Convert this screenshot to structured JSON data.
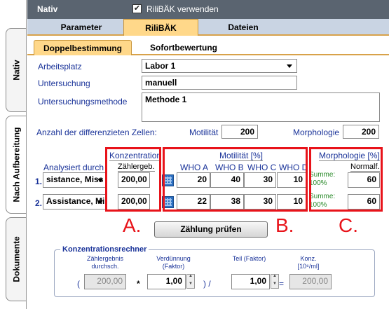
{
  "sidebar": {
    "tabs": [
      {
        "label": "Nativ"
      },
      {
        "label": "Nach Aufbereitung"
      },
      {
        "label": "Dokumente"
      }
    ]
  },
  "header": {
    "title": "Nativ",
    "checkbox_label": "RiliBÄK verwenden",
    "checkbox_checked": true
  },
  "tabs": [
    {
      "label": "Parameter"
    },
    {
      "label": "RiliBÄK"
    },
    {
      "label": "Dateien"
    }
  ],
  "subtabs": [
    {
      "label": "Doppelbestimmung"
    },
    {
      "label": "Sofortbewertung"
    }
  ],
  "form": {
    "arbeitsplatz_label": "Arbeitsplatz",
    "arbeitsplatz_value": "Labor 1",
    "untersuchung_label": "Untersuchung",
    "untersuchung_value": "manuell",
    "methode_label": "Untersuchungsmethode",
    "methode_value": "Methode 1",
    "zellen_label": "Anzahl der differenzieten Zellen:",
    "motilitaet_label": "Motilität",
    "motilitaet_value": "200",
    "morphologie_label": "Morphologie",
    "morphologie_value": "200"
  },
  "grid": {
    "analysiert_label": "Analysiert durch",
    "konz_header": "Konzentration",
    "zaehlergeb_label": "Zählergeb.",
    "motil_header": "Motilität [%]",
    "who": [
      "WHO A",
      "WHO B",
      "WHO C",
      "WHO  D"
    ],
    "morph_header": "Morphologie [%]",
    "normalf_label": "Normalf.",
    "rows": [
      {
        "num": "1.",
        "analyst": "sistance, Miss",
        "zaehler": "200,00",
        "a": "20",
        "b": "40",
        "c": "30",
        "d": "10",
        "summe": "Summe:",
        "pct": "100%",
        "normal": "60"
      },
      {
        "num": "2.",
        "analyst": "Assistance, Mi",
        "zaehler": "200,00",
        "a": "22",
        "b": "38",
        "c": "30",
        "d": "10",
        "summe": "Summe:",
        "pct": "100%",
        "normal": "60"
      }
    ]
  },
  "annotations": {
    "a": "A.",
    "b": "B.",
    "c": "C."
  },
  "buttons": {
    "zaehlung": "Zählung prüfen"
  },
  "calc": {
    "title": "Konzentrationsrechner",
    "col1": "Zählergebnis durchsch.",
    "col2": "Verdünnung (Faktor)",
    "col3": "Teil (Faktor)",
    "col4a": "Konz.",
    "col4b": "[10⁶/ml]",
    "open_paren": "(",
    "v1": "200,00",
    "times": "*",
    "v2": "1,00",
    "close_slash": ") /",
    "v3": "1,00",
    "eq": "=",
    "v4": "200,00"
  },
  "colors": {
    "accent_red": "#e8131a",
    "header_bg": "#5a6470",
    "tab_active": "#ffd88a",
    "label_blue": "#1a3399"
  }
}
